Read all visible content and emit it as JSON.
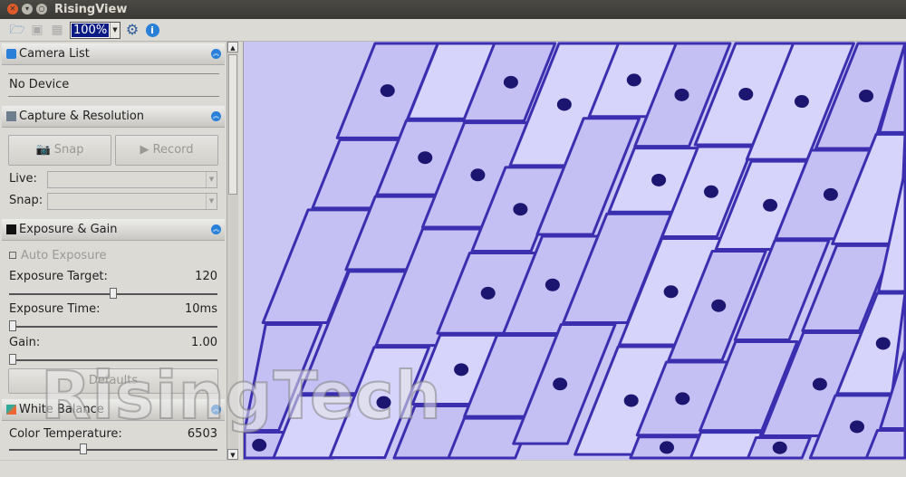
{
  "window": {
    "title": "RisingView"
  },
  "toolbar": {
    "zoom": "100%",
    "icons": [
      "folder-open-icon",
      "save-icon",
      "save-as-icon",
      "settings-gear-icon",
      "info-icon"
    ]
  },
  "panel": {
    "camera_list": {
      "title": "Camera List",
      "device": "No Device"
    },
    "capture": {
      "title": "Capture & Resolution",
      "snap": "Snap",
      "record": "Record",
      "live_label": "Live:",
      "snap_label": "Snap:"
    },
    "exposure": {
      "title": "Exposure & Gain",
      "auto_exposure": "Auto Exposure",
      "auto_checked": false,
      "target_label": "Exposure Target:",
      "target_value": "120",
      "target_fraction": 0.5,
      "time_label": "Exposure Time:",
      "time_value": "10ms",
      "time_fraction": 0.0,
      "gain_label": "Gain:",
      "gain_value": "1.00",
      "gain_fraction": 0.0,
      "defaults": "Defaults"
    },
    "white_balance": {
      "title": "White Balance",
      "temp_label": "Color Temperature:",
      "temp_value": "6503",
      "temp_fraction": 0.35
    }
  },
  "watermark": "RisingTech",
  "colors": {
    "accent": "#2a7fd8",
    "zoom_highlight": "#0c1a84",
    "stain": "#3b2fb0"
  }
}
